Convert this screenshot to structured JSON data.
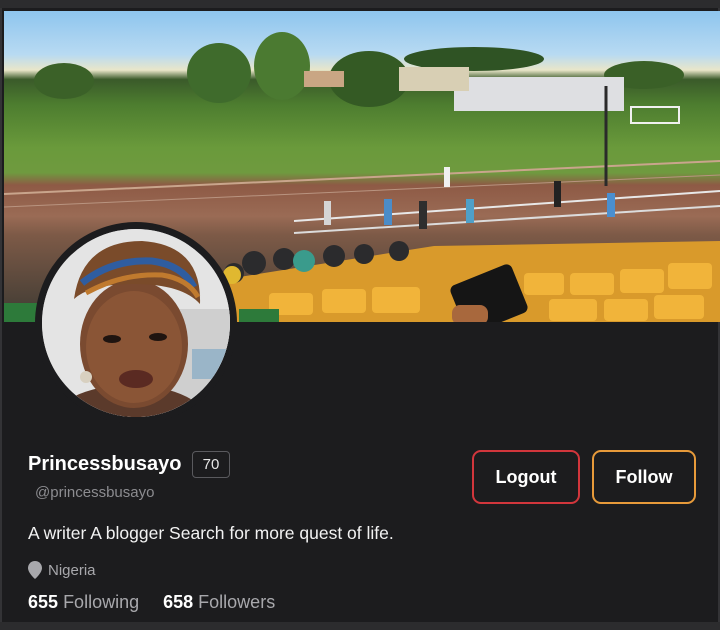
{
  "profile": {
    "display_name": "Princessbusayo",
    "score_badge": "70",
    "handle": "@princessbusayo",
    "bio": "A writer A blogger Search for more quest of life.",
    "location": "Nigeria",
    "stats": {
      "following_count": "655",
      "following_label": "Following",
      "followers_count": "658",
      "followers_label": "Followers"
    }
  },
  "actions": {
    "logout_label": "Logout",
    "follow_label": "Follow"
  },
  "icons": {
    "location": "location-pin-icon"
  },
  "colors": {
    "background": "#1c1c1e",
    "logout_border": "#d2363c",
    "follow_border": "#e79a3a",
    "muted_text": "#a8a8ac"
  }
}
